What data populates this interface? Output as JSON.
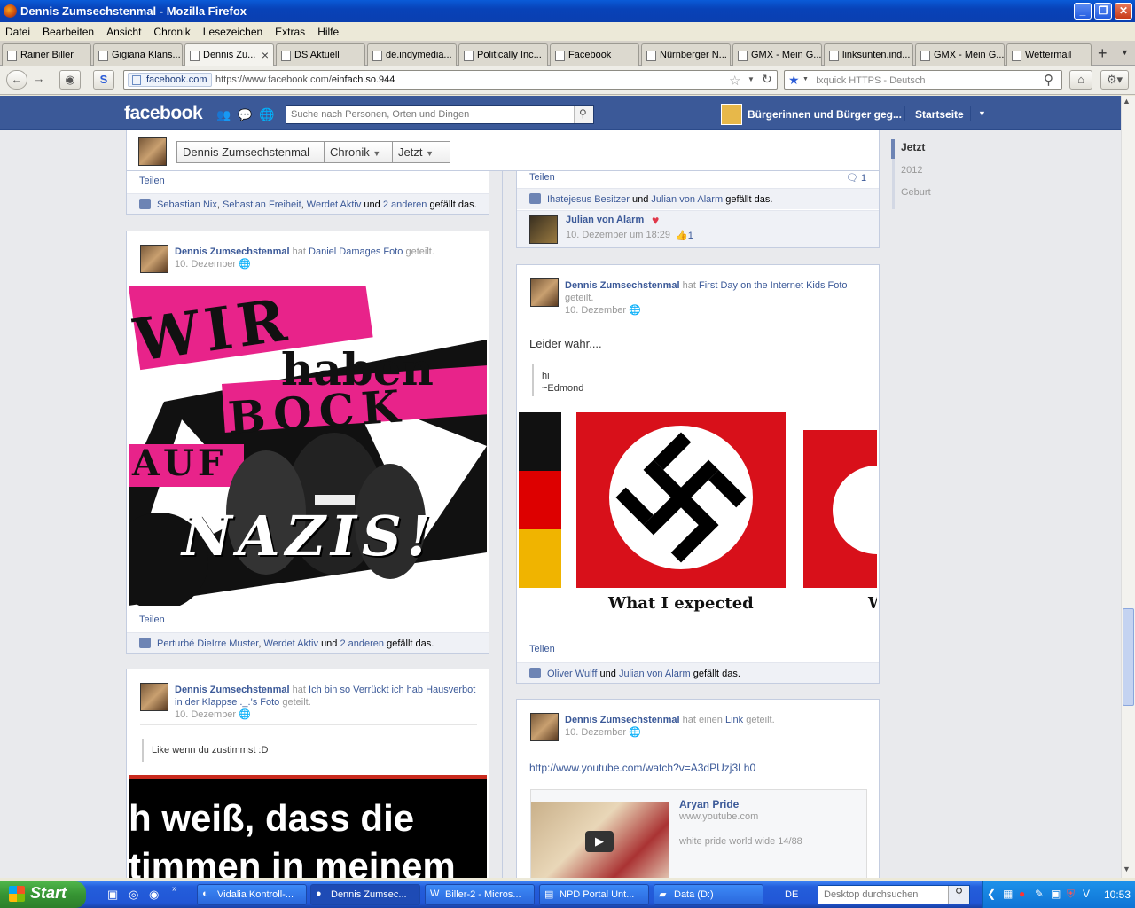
{
  "window": {
    "title": "Dennis Zumsechstenmal - Mozilla Firefox"
  },
  "menu": [
    "Datei",
    "Bearbeiten",
    "Ansicht",
    "Chronik",
    "Lesezeichen",
    "Extras",
    "Hilfe"
  ],
  "tabs": [
    "Rainer Biller",
    "Gigiana Klans...",
    "Dennis Zu...",
    "DS Aktuell",
    "de.indymedia...",
    "Politically Inc...",
    "Facebook",
    "Nürnberger N...",
    "GMX - Mein G...",
    "linksunten.ind...",
    "GMX - Mein G...",
    "Wettermail"
  ],
  "nav": {
    "site": "facebook.com",
    "url_prefix": "https://www.facebook.com/",
    "url_path": "einfach.so.944",
    "search_placeholder": "Ixquick HTTPS - Deutsch"
  },
  "fb": {
    "logo": "facebook",
    "search_placeholder": "Suche nach Personen, Orten und Dingen",
    "page_name": "Bürgerinnen und Bürger geg...",
    "home": "Startseite",
    "profile_name": "Dennis Zumsechstenmal",
    "chronik_btn": "Chronik",
    "jetzt_btn": "Jetzt"
  },
  "timeline_nav": [
    "Jetzt",
    "2012",
    "Geburt"
  ],
  "left": {
    "top_share": "Teilen",
    "top_likes": {
      "names": [
        "Sebastian Nix",
        "Sebastian Freiheit",
        "Werdet Aktiv"
      ],
      "and": "und",
      "others": "2 anderen",
      "suffix": "gefällt das."
    },
    "post1": {
      "author": "Dennis Zumsechstenmal",
      "verb": "hat",
      "source": "Daniel Damages Foto",
      "verb2": "geteilt.",
      "date": "10. Dezember",
      "image_text": [
        "WIR",
        "haben",
        "BOCK",
        "AUF",
        "NAZIS!"
      ],
      "share": "Teilen",
      "likes": {
        "names": [
          "Perturbé DieIrre Muster",
          "Werdet Aktiv"
        ],
        "and": "und",
        "others": "2 anderen",
        "suffix": "gefällt das."
      }
    },
    "post2": {
      "author": "Dennis Zumsechstenmal",
      "verb": "hat",
      "source": "Ich bin so Verrückt ich hab Hausverbot in der Klappse ._.'s Foto",
      "verb2": "geteilt.",
      "date": "10. Dezember",
      "quote": "Like wenn du zustimmst :D",
      "image_text": [
        "h weiß, dass die",
        "timmen in meinem"
      ]
    }
  },
  "right": {
    "top_share": "Teilen",
    "top_comment_count": "1",
    "top_likes": {
      "names": [
        "Ihatejesus Besitzer",
        "Julian von Alarm"
      ],
      "and": "und",
      "suffix": "gefällt das."
    },
    "comment": {
      "author": "Julian von Alarm",
      "date": "10. Dezember um 18:29",
      "likes": "1"
    },
    "post1": {
      "author": "Dennis Zumsechstenmal",
      "verb": "hat",
      "source": "First Day on the Internet Kids Foto",
      "verb2": "geteilt.",
      "date": "10. Dezember",
      "text": "Leider wahr....",
      "quote_lines": [
        "hi",
        "~Edmond"
      ],
      "caption": "What I expected",
      "caption2": "W",
      "share": "Teilen",
      "likes": {
        "names": [
          "Oliver Wulff",
          "Julian von Alarm"
        ],
        "and": "und",
        "suffix": "gefällt das."
      }
    },
    "post2": {
      "author": "Dennis Zumsechstenmal",
      "verb": "hat einen",
      "source": "Link",
      "verb2": "geteilt.",
      "date": "10. Dezember",
      "link": "http://www.youtube.com/watch?v=A3dPUzj3Lh0",
      "preview": {
        "title": "Aryan Pride",
        "domain": "www.youtube.com",
        "desc": "white pride world wide 14/88"
      }
    }
  },
  "taskbar": {
    "start": "Start",
    "tasks": [
      "Vidalia Kontroll-...",
      "Dennis Zumsec...",
      "Biller-2 - Micros...",
      "NPD Portal Unt...",
      "Data (D:)"
    ],
    "lang": "DE",
    "desktop_search": "Desktop durchsuchen",
    "clock": "10:53"
  }
}
